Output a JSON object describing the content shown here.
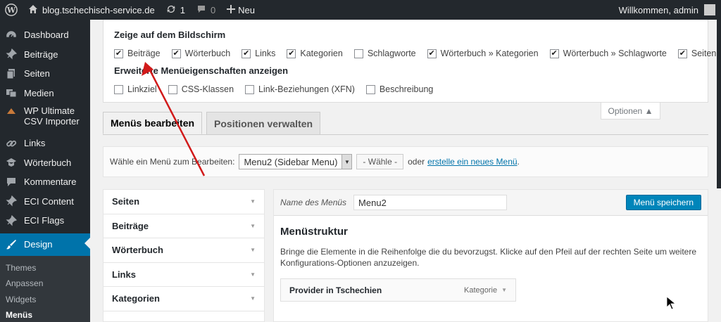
{
  "adminbar": {
    "site_name": "blog.tschechisch-service.de",
    "updates_count": "1",
    "comments_count": "0",
    "new_label": "Neu",
    "welcome": "Willkommen, admin"
  },
  "sidebar": {
    "items": [
      {
        "label": "Dashboard",
        "icon": "dashboard-icon"
      },
      {
        "label": "Beiträge",
        "icon": "pin-icon"
      },
      {
        "label": "Seiten",
        "icon": "pages-icon"
      },
      {
        "label": "Medien",
        "icon": "media-icon"
      },
      {
        "label": "WP Ultimate CSV Importer",
        "icon": "importer-icon"
      },
      {
        "label": "Links",
        "icon": "links-icon"
      },
      {
        "label": "Wörterbuch",
        "icon": "dictionary-icon"
      },
      {
        "label": "Kommentare",
        "icon": "comments-icon"
      },
      {
        "label": "ECI Content",
        "icon": "pin-icon"
      },
      {
        "label": "ECI Flags",
        "icon": "pin-icon"
      },
      {
        "label": "Design",
        "icon": "design-icon"
      }
    ],
    "submenu": [
      "Themes",
      "Anpassen",
      "Widgets",
      "Menüs"
    ]
  },
  "screen_options": {
    "title": "Zeige auf dem Bildschirm",
    "boxes": [
      {
        "label": "Beiträge",
        "checked": true
      },
      {
        "label": "Wörterbuch",
        "checked": true
      },
      {
        "label": "Links",
        "checked": true
      },
      {
        "label": "Kategorien",
        "checked": true
      },
      {
        "label": "Schlagworte",
        "checked": false
      },
      {
        "label": "Wörterbuch » Kategorien",
        "checked": true
      },
      {
        "label": "Wörterbuch » Schlagworte",
        "checked": true
      },
      {
        "label": "Seiten",
        "checked": true
      }
    ],
    "advanced_title": "Erweiterte Menüeigenschaften anzeigen",
    "advanced": [
      {
        "label": "Linkziel",
        "checked": false
      },
      {
        "label": "CSS-Klassen",
        "checked": false
      },
      {
        "label": "Link-Beziehungen (XFN)",
        "checked": false
      },
      {
        "label": "Beschreibung",
        "checked": false
      }
    ],
    "toggle_label": "Optionen ▲"
  },
  "tabs": [
    "Menüs bearbeiten",
    "Positionen verwalten"
  ],
  "manage": {
    "label": "Wähle ein Menü zum Bearbeiten:",
    "selected": "Menu2 (Sidebar Menu)",
    "select_btn": "- Wähle -",
    "or_text": "oder",
    "create_link": "erstelle ein neues Menü",
    "period": "."
  },
  "accordion": [
    "Seiten",
    "Beiträge",
    "Wörterbuch",
    "Links",
    "Kategorien"
  ],
  "menu": {
    "name_label": "Name des Menüs",
    "name_value": "Menu2",
    "save_label": "Menü speichern",
    "structure_title": "Menüstruktur",
    "description": "Bringe die Elemente in die Reihenfolge die du bevorzugst. Klicke auf den Pfeil auf der rechten Seite um weitere Konfigurations-Optionen anzuzeigen.",
    "item_title": "Provider in Tschechien",
    "item_type": "Kategorie"
  },
  "colors": {
    "admin_dark": "#23282d",
    "accent": "#0073aa",
    "annotation_arrow": "#d11a1a"
  }
}
